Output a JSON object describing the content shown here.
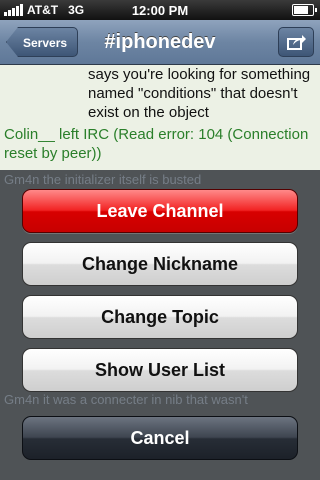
{
  "status_bar": {
    "carrier": "AT&T",
    "network": "3G",
    "time": "12:00 PM",
    "battery_level": 0.9
  },
  "nav": {
    "back_label": "Servers",
    "title": "#iphonedev"
  },
  "chat": {
    "messages": [
      {
        "text": "says you're looking for something named \"conditions\" that doesn't exist on the object"
      },
      {
        "text": "Colin__ left IRC (Read error: 104 (Connection reset by peer))"
      }
    ],
    "dimmed_lines": [
      "Gm4n  the initializer itself is busted",
      "Gm4n  it was a connecter in nib that wasn't"
    ]
  },
  "action_sheet": {
    "leave": "Leave Channel",
    "nickname": "Change Nickname",
    "topic": "Change Topic",
    "users": "Show User List",
    "cancel": "Cancel"
  }
}
